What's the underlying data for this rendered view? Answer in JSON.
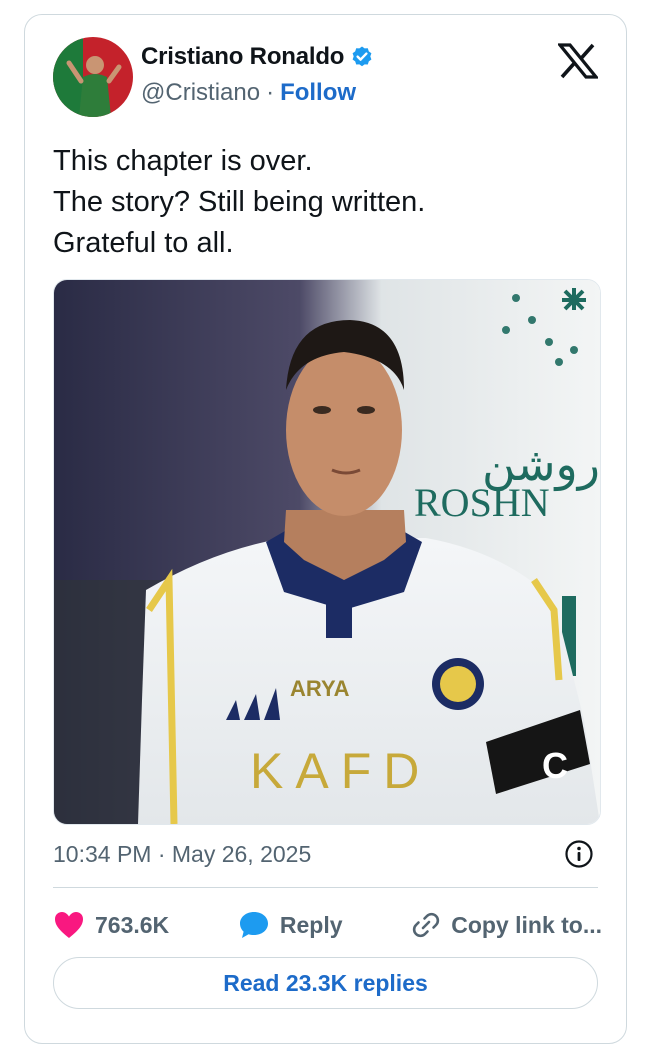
{
  "author": {
    "display_name": "Cristiano Ronaldo",
    "handle": "@Cristiano",
    "separator": "·",
    "follow_label": "Follow",
    "verified": true
  },
  "tweet": {
    "lines": [
      "This chapter is over.",
      "The story? Still being written.",
      "Grateful to all."
    ],
    "timestamp": "10:34 PM · May 26, 2025"
  },
  "media": {
    "shirt_sponsor": "KAFD",
    "shirt_brand": "ARYA",
    "banner_arabic": "روشن",
    "banner_text": "ROSHN",
    "armband": "C"
  },
  "actions": {
    "likes": "763.6K",
    "reply_label": "Reply",
    "copy_label": "Copy link to..."
  },
  "read_replies_label": "Read 23.3K replies",
  "colors": {
    "accent": "#1d6bc9",
    "like": "#f91880",
    "text": "#0f1419",
    "muted": "#536471",
    "border": "#cfd9de"
  },
  "icons": [
    "verified-badge-icon",
    "x-logo-icon",
    "info-icon",
    "heart-icon",
    "reply-bubble-icon",
    "link-icon"
  ]
}
